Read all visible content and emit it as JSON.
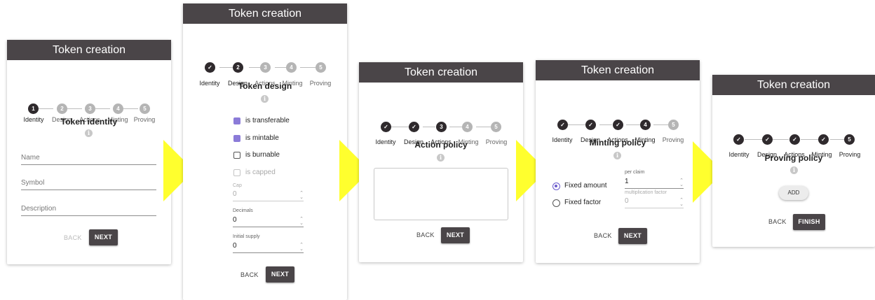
{
  "title": "Token creation",
  "steps": [
    "Identity",
    "Design",
    "Actions",
    "Minting",
    "Proving"
  ],
  "step_numbers": [
    "1",
    "2",
    "3",
    "4",
    "5"
  ],
  "check": "✓",
  "info": "i",
  "back": "BACK",
  "next": "NEXT",
  "finish": "FINISH",
  "panel1": {
    "section": "Token identity",
    "fields": {
      "name": "Name",
      "symbol": "Symbol",
      "description": "Description"
    }
  },
  "panel2": {
    "section": "Token design",
    "checkboxes": [
      "is transferable",
      "is mintable",
      "is burnable",
      "is capped"
    ],
    "cap": {
      "label": "Cap",
      "value": "0"
    },
    "decimals": {
      "label": "Decimals",
      "value": "0"
    },
    "initial_supply": {
      "label": "Initial supply",
      "value": "0"
    }
  },
  "panel3": {
    "section": "Action policy"
  },
  "panel4": {
    "section": "Minting policy",
    "option_amount": "Fixed amount",
    "option_factor": "Fixed factor",
    "per_claim_label": "per claim",
    "per_claim_value": "1",
    "factor_label": "multiplication factor",
    "factor_value": "0"
  },
  "panel5": {
    "section": "Proving policy",
    "add": "ADD"
  },
  "colors": {
    "header": "#4a4548",
    "accent": "#8b7bd8",
    "arrow": "#ffff2e",
    "step_active": "#2f2a2d",
    "step_todo": "#b5b5b5"
  }
}
